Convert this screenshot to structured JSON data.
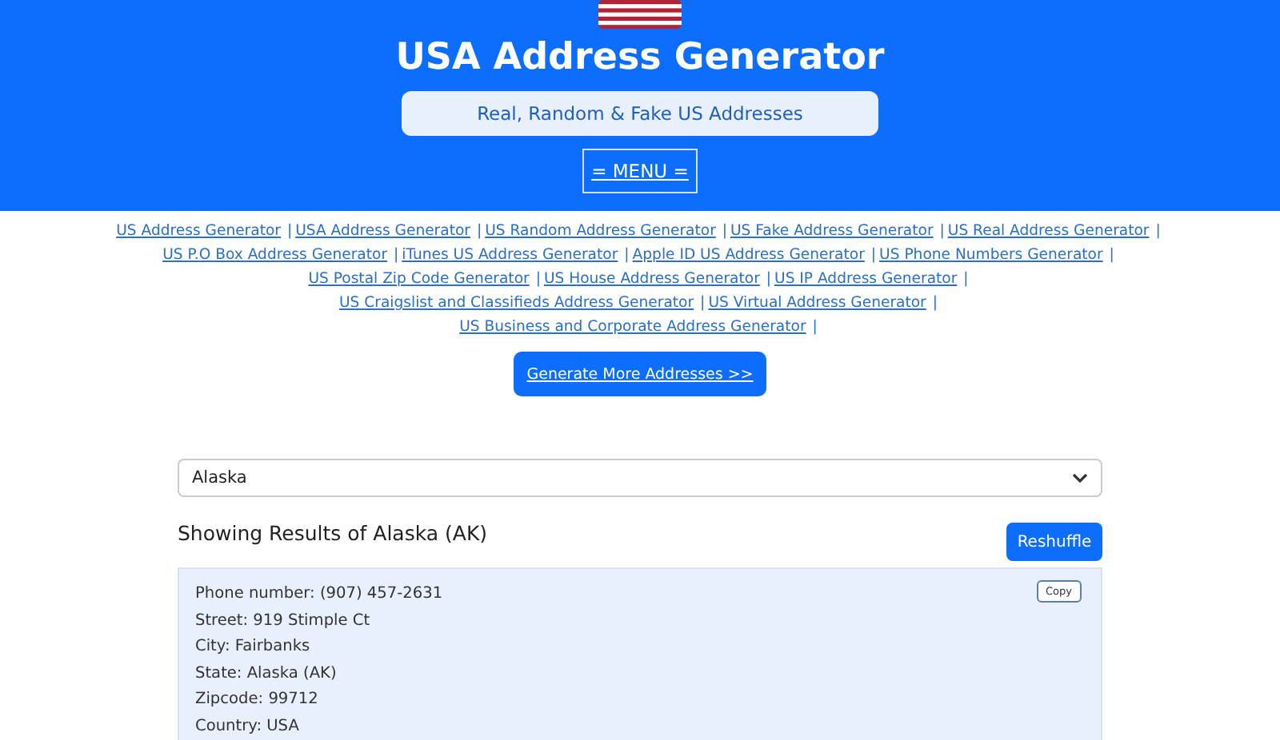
{
  "header": {
    "title": "USA Address Generator",
    "subtitle": "Real, Random & Fake US Addresses",
    "menu_button": "= MENU ="
  },
  "link_lines": [
    [
      {
        "label": "US Address Generator",
        "separator": "|"
      },
      {
        "label": "USA Address Generator",
        "separator": "|"
      },
      {
        "label": "US Random Address Generator",
        "separator": "|"
      },
      {
        "label": "US Fake Address Generator",
        "separator": "|"
      },
      {
        "label": "US Real Address Generator",
        "separator": "|"
      }
    ],
    [
      {
        "label": "US P.O Box Address Generator",
        "separator": "|"
      },
      {
        "label": "iTunes US Address Generator",
        "separator": "|"
      },
      {
        "label": "Apple ID US Address Generator",
        "separator": "|"
      },
      {
        "label": "US Phone Numbers Generator",
        "separator": "|"
      }
    ],
    [
      {
        "label": "US Postal Zip Code Generator",
        "separator": "|"
      },
      {
        "label": "US House Address Generator",
        "separator": "|"
      },
      {
        "label": "US IP Address Generator",
        "separator": "|"
      }
    ],
    [
      {
        "label": "US Craigslist and Classifieds Address Generator",
        "separator": "|"
      },
      {
        "label": "US Virtual Address Generator",
        "separator": "|"
      }
    ],
    [
      {
        "label": "US Business and Corporate Address Generator",
        "separator": "|"
      }
    ]
  ],
  "generate_button": "Generate More Addresses >>",
  "state_select": {
    "value": "Alaska"
  },
  "results": {
    "heading": "Showing Results of Alaska (AK)",
    "reshuffle_button": "Reshuffle",
    "copy_button": "Copy",
    "lines": [
      "Phone number: (907) 457-2631",
      "Street: 919 Stimple Ct",
      "City: Fairbanks",
      "State: Alaska (AK)",
      "Zipcode: 99712",
      "Country: USA"
    ]
  }
}
